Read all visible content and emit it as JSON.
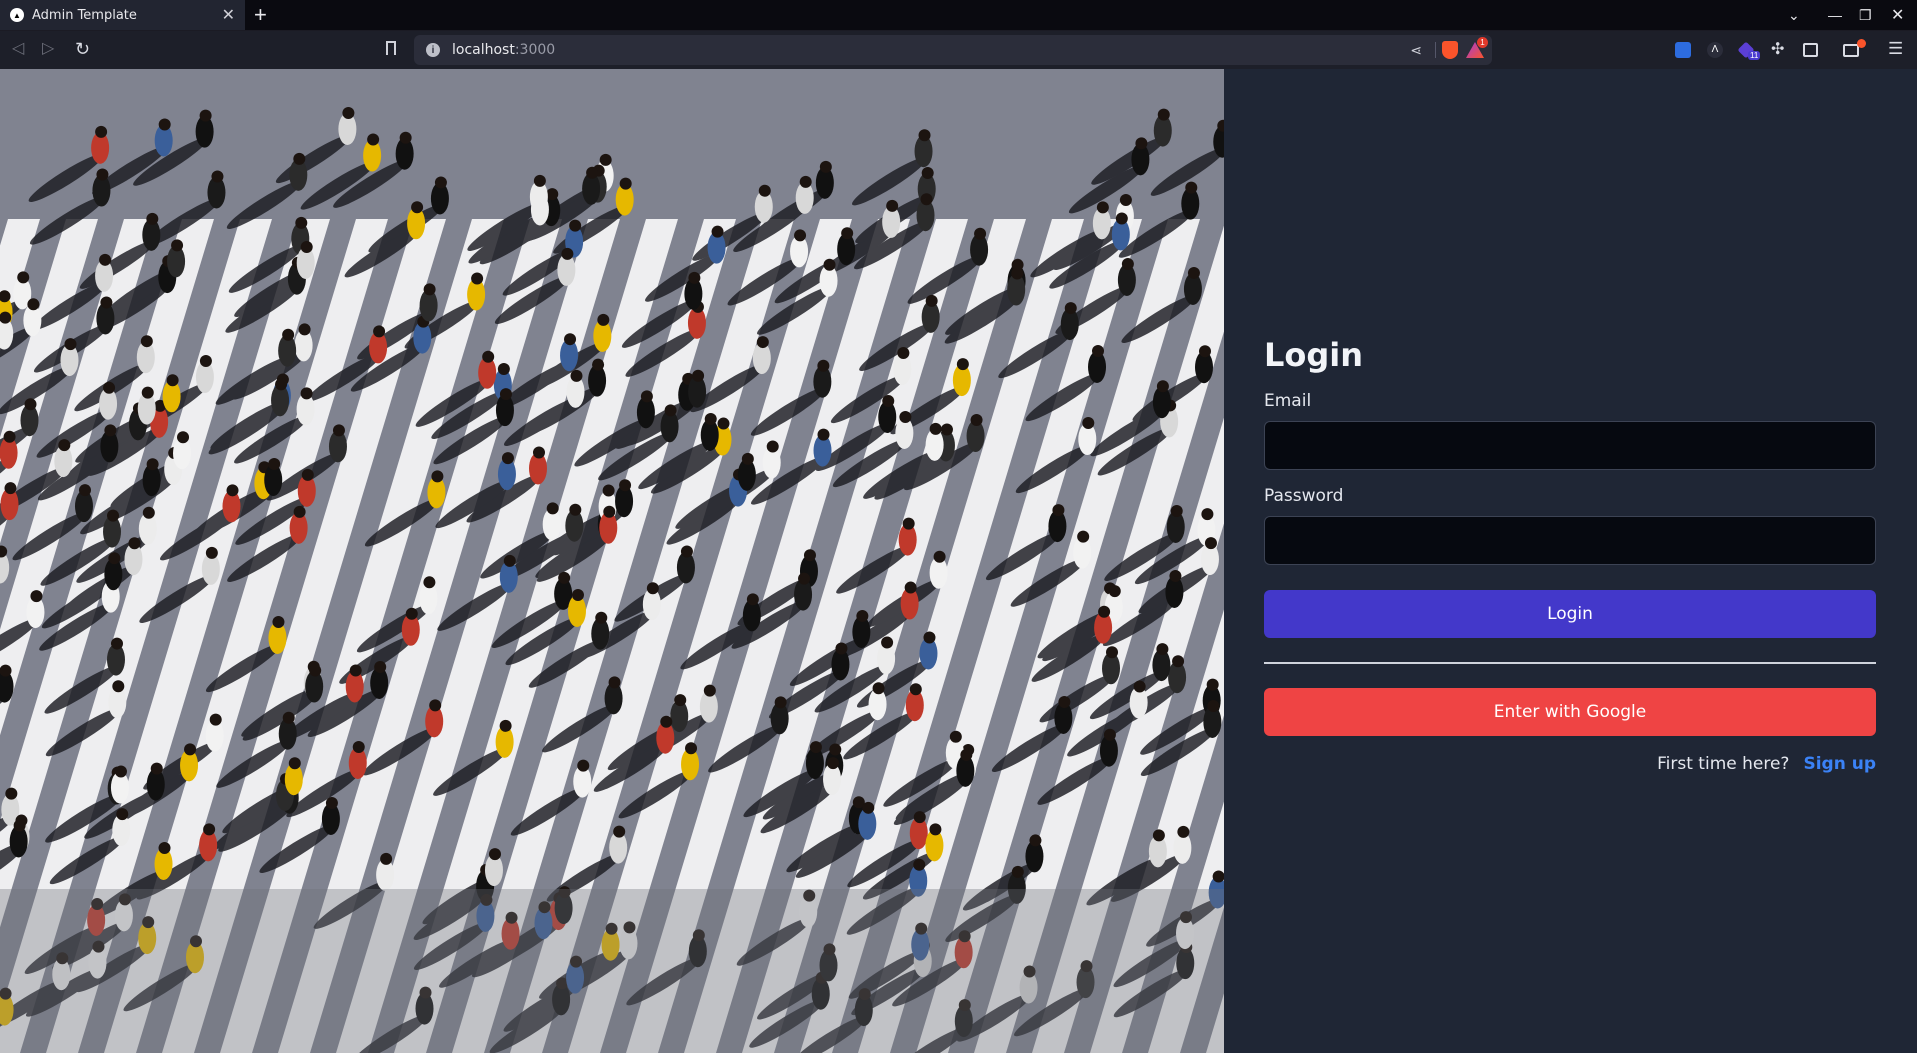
{
  "browser": {
    "tab_title": "Admin Template",
    "url_host": "localhost",
    "url_port": ":3000",
    "extension_badge": "11",
    "rewards_badge": "1"
  },
  "login": {
    "title": "Login",
    "email_label": "Email",
    "email_value": "",
    "password_label": "Password",
    "password_value": "",
    "login_button": "Login",
    "google_button": "Enter with Google",
    "first_time_text": "First time here?",
    "signup_link": "Sign up"
  },
  "colors": {
    "panel_bg": "#1f2635",
    "primary": "#4338ca",
    "google": "#ef4444",
    "link": "#3b82f6"
  },
  "icons": {
    "back": "back-icon",
    "forward": "forward-icon",
    "reload": "reload-icon",
    "bookmark": "bookmark-icon",
    "share": "share-icon",
    "brave": "brave-shield-icon",
    "rewards": "brave-rewards-icon",
    "extensions": "puzzle-icon",
    "sidebar": "sidebar-icon",
    "wallet": "wallet-icon",
    "menu": "hamburger-menu-icon"
  }
}
